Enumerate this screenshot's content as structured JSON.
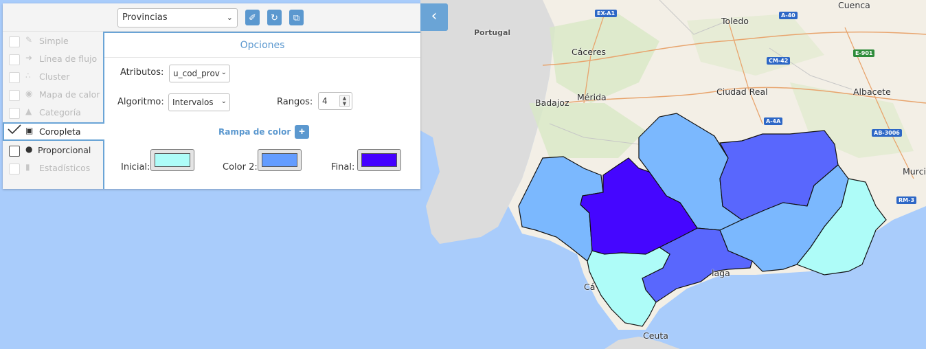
{
  "toolbar": {
    "layer_select_value": "Provincias",
    "collapse_icon": "chevron-left-icon",
    "buttons": [
      "brush-icon",
      "reset-icon",
      "copy-icon"
    ]
  },
  "menu": {
    "items": [
      {
        "label": "Simple",
        "icon": "simple-icon"
      },
      {
        "label": "Línea de flujo",
        "icon": "arrow-right-icon"
      },
      {
        "label": "Cluster",
        "icon": "cluster-icon"
      },
      {
        "label": "Mapa de calor",
        "icon": "heatmap-icon"
      },
      {
        "label": "Categoría",
        "icon": "category-icon"
      },
      {
        "label": "Coropleta",
        "icon": "choropleth-icon"
      },
      {
        "label": "Proporcional",
        "icon": "proportional-icon"
      },
      {
        "label": "Estadísticos",
        "icon": "stats-icon"
      }
    ]
  },
  "options": {
    "title": "Opciones",
    "attributes_label": "Atributos:",
    "attributes_value": "u_cod_prov",
    "algorithm_label": "Algoritmo:",
    "algorithm_value": "Intervalos",
    "ranges_label": "Rangos:",
    "ranges_value": "4",
    "ramp_title": "Rampa de color",
    "ramp_add": "+",
    "initial_label": "Inicial:",
    "color2_label": "Color 2:",
    "final_label": "Final:",
    "colors": {
      "initial": "#aefcf8",
      "color2": "#639cff",
      "final": "#4400ff"
    }
  },
  "map": {
    "labels": {
      "portugal": "Portugal",
      "caceres": "Cáceres",
      "toledo": "Toledo",
      "cuenca": "Cuenca",
      "badajoz": "Badajoz",
      "merida": "Mérida",
      "ciudad_real": "Ciudad Real",
      "albacete": "Albacete",
      "murcia": "Murci",
      "ceuta": "Ceuta",
      "cadiz": "Cá",
      "malaga": "laga"
    },
    "roads": {
      "exa1": "EX-A1",
      "a40": "A-40",
      "e901": "E-901",
      "cm42": "CM-42",
      "a4a": "A-4A",
      "ab3006": "AB-3006",
      "rm3": "RM-3"
    },
    "province_colors": {
      "huelva": "#7bb8fe",
      "sevilla": "#4506ff",
      "cordoba": "#7bb8fe",
      "jaen": "#5967fd",
      "granada": "#7bb8fe",
      "almeria": "#aefcf8",
      "malaga": "#5967fd",
      "cadiz": "#aefcf8"
    }
  }
}
